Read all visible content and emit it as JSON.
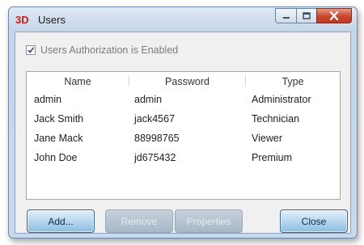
{
  "window": {
    "title": "Users",
    "app_icon_label": "3D",
    "accent_color": "#c0391f"
  },
  "auth": {
    "checked": true,
    "label": "Users Authorization is Enabled"
  },
  "table": {
    "columns": [
      "Name",
      "Password",
      "Type"
    ],
    "rows": [
      [
        "admin",
        "admin",
        "Administrator"
      ],
      [
        "Jack Smith",
        "jack4567",
        "Technician"
      ],
      [
        "Jane Mack",
        "88998765",
        "Viewer"
      ],
      [
        "John Doe",
        "jd675432",
        "Premium"
      ]
    ]
  },
  "buttons": {
    "add": "Add...",
    "remove": "Remove",
    "properties": "Properties",
    "close": "Close"
  }
}
